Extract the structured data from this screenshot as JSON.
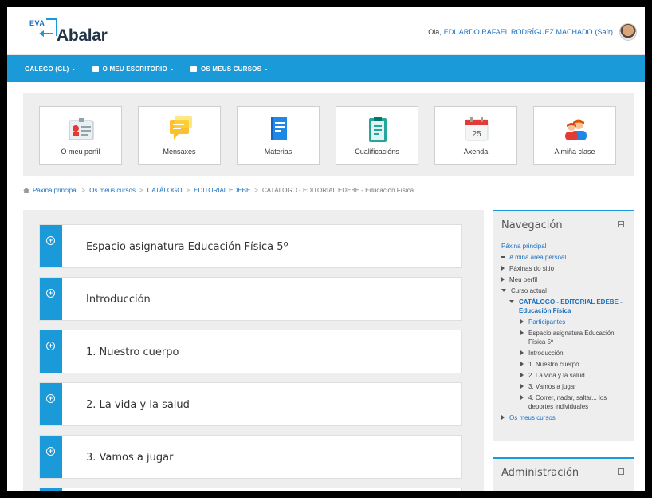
{
  "header": {
    "logo_small": "EVA",
    "logo_text": "Abalar",
    "greeting": "Ola,",
    "user_name": "EDUARDO RAFAEL RODRÍGUEZ MACHADO",
    "logout": "(Saír)"
  },
  "navbar": {
    "items": [
      {
        "label": "GALEGO (GL)",
        "caret": "⌄",
        "icon": ""
      },
      {
        "label": "O MEU ESCRITORIO",
        "caret": "⌄",
        "icon": "dashboard-icon"
      },
      {
        "label": "OS MEUS CURSOS",
        "caret": "⌄",
        "icon": "courses-icon"
      }
    ]
  },
  "tiles": [
    {
      "label": "O meu perfil",
      "icon": "profile-card-icon"
    },
    {
      "label": "Mensaxes",
      "icon": "messages-icon"
    },
    {
      "label": "Materias",
      "icon": "book-icon"
    },
    {
      "label": "Cualificacións",
      "icon": "clipboard-icon"
    },
    {
      "label": "Axenda",
      "icon": "calendar-icon",
      "day": "25"
    },
    {
      "label": "A miña clase",
      "icon": "class-people-icon"
    }
  ],
  "breadcrumb": {
    "home": "Páxina principal",
    "crumb1": "Os meus cursos",
    "crumb2": "CATÁLOGO",
    "crumb3": "EDITORIAL EDEBE",
    "current": "CATÁLOGO - EDITORIAL EDEBE - Educación Física",
    "sep": ">"
  },
  "sections": [
    {
      "title": "Espacio asignatura Educación Física 5º"
    },
    {
      "title": "Introducción"
    },
    {
      "title": "1. Nuestro cuerpo"
    },
    {
      "title": "2. La vida y la salud"
    },
    {
      "title": "3. Vamos a jugar"
    }
  ],
  "section_toggle": "+",
  "navigation": {
    "title": "Navegación",
    "home": "Páxina principal",
    "my_area": "A miña área persoal",
    "site_pages": "Páxinas do sitio",
    "my_profile": "Meu perfil",
    "current_course": "Curso actual",
    "course_name": "CATÁLOGO - EDITORIAL EDEBE - Educación Física",
    "participants": "Participantes",
    "items": [
      "Espacio asignatura Educación Física 5º",
      "Introducción",
      "1. Nuestro cuerpo",
      "2. La vida y la salud",
      "3. Vamos a jugar",
      "4. Correr, nadar, saltar... los deportes individuales"
    ],
    "my_courses": "Os meus cursos"
  },
  "administration": {
    "title": "Administración"
  },
  "colors": {
    "accent": "#1a9ad9",
    "link": "#1a6fc0",
    "panel": "#eeeeee"
  }
}
